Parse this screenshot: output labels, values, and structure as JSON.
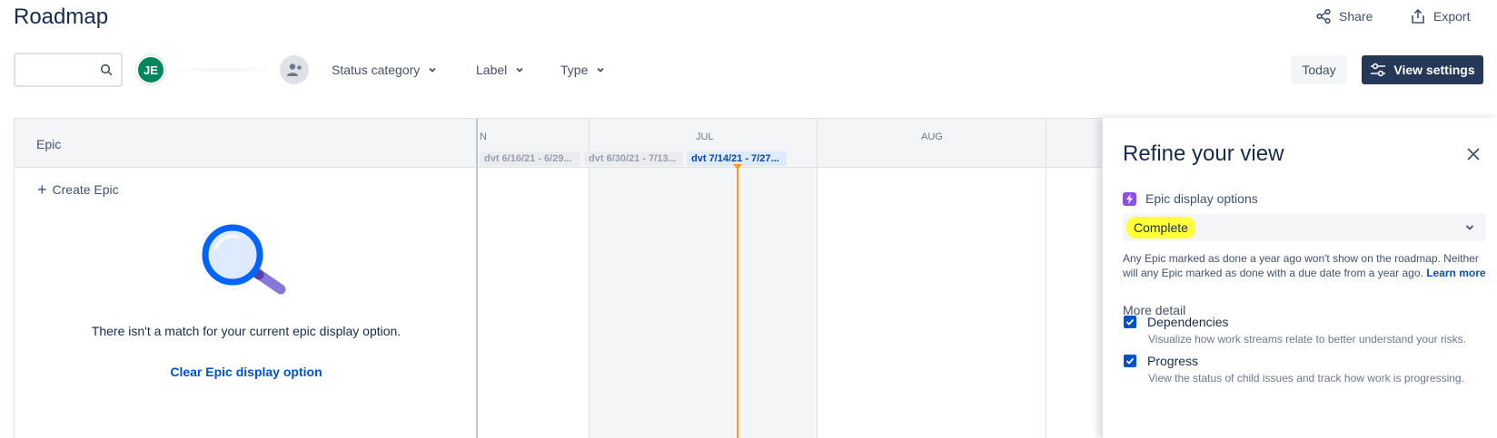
{
  "page": {
    "title": "Roadmap"
  },
  "header": {
    "share_label": "Share",
    "export_label": "Export"
  },
  "toolbar": {
    "search_placeholder": "",
    "avatar_initials": "JE",
    "filters": [
      {
        "label": "Status category"
      },
      {
        "label": "Label"
      },
      {
        "label": "Type"
      }
    ],
    "today_label": "Today",
    "view_settings_label": "View settings"
  },
  "epics": {
    "column_header": "Epic",
    "create_label": "Create Epic",
    "empty_message": "There isn't a match for your current epic display option.",
    "clear_link": "Clear Epic display option"
  },
  "timeline": {
    "months": [
      "N",
      "JUL",
      "AUG"
    ],
    "sprints": [
      {
        "label": "dvt 6/16/21 - 6/29...",
        "state": "past"
      },
      {
        "label": "dvt 6/30/21 - 7/13...",
        "state": "past"
      },
      {
        "label": "dvt 7/14/21 - 7/27...",
        "state": "current"
      }
    ]
  },
  "refine_panel": {
    "title": "Refine your view",
    "epic_display_label": "Epic display options",
    "epic_display_value": "Complete",
    "description": "Any Epic marked as done a year ago won't show on the roadmap. Neither will any Epic marked as done with a due date from a year ago.",
    "learn_more": "Learn more",
    "more_detail_label": "More detail",
    "options": [
      {
        "label": "Dependencies",
        "checked": true,
        "description": "Visualize how work streams relate to better understand your risks."
      },
      {
        "label": "Progress",
        "checked": true,
        "description": "View the status of child issues and track how work is progressing."
      }
    ]
  },
  "colors": {
    "accent": "#0052cc",
    "primary_button": "#253858",
    "today_line": "#ff991f",
    "highlight": "#ffff3b",
    "avatar": "#00875a"
  }
}
